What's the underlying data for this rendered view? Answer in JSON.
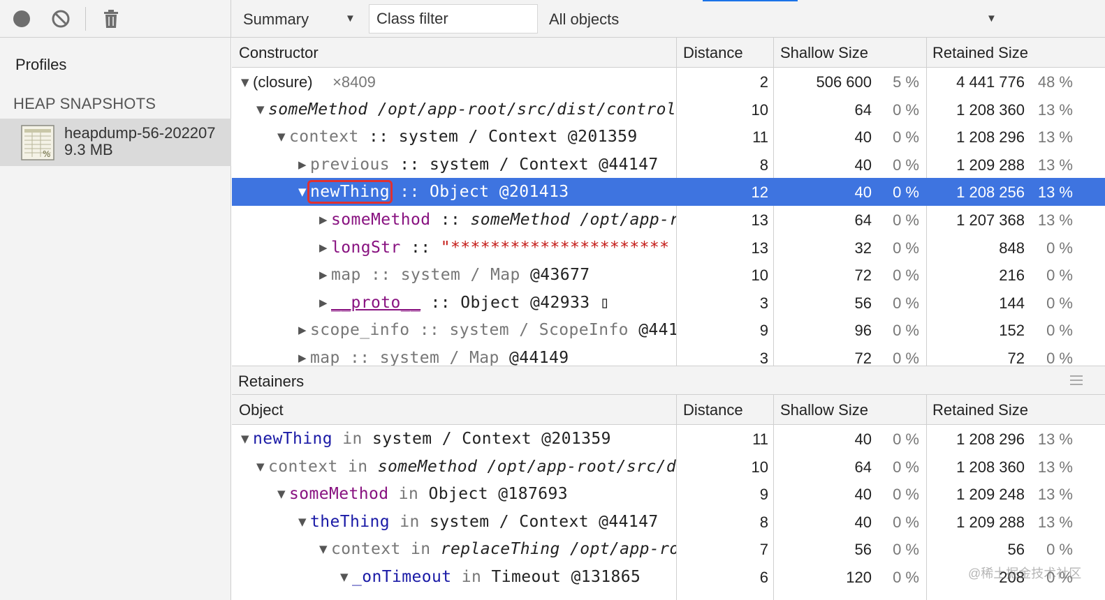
{
  "toolbar": {
    "view_select": "Summary",
    "class_filter_placeholder": "Class filter",
    "objects_select": "All objects"
  },
  "sidebar": {
    "profiles_label": "Profiles",
    "section_heading": "HEAP SNAPSHOTS",
    "snapshot": {
      "name": "heapdump-56-202207",
      "size": "9.3 MB"
    }
  },
  "constructor_table": {
    "headers": {
      "name": "Constructor",
      "distance": "Distance",
      "shallow": "Shallow Size",
      "retained": "Retained Size"
    },
    "rows": [
      {
        "dist": "2",
        "sh": "506 600",
        "shp": "5 %",
        "ret": "4 441 776",
        "retp": "48 %",
        "n1": "(closure)",
        "n2": "×8409"
      },
      {
        "dist": "10",
        "sh": "64",
        "shp": "0 %",
        "ret": "1 208 360",
        "retp": "13 %",
        "n1": "someMethod /opt/app-root/src/dist/control"
      },
      {
        "dist": "11",
        "sh": "40",
        "shp": "0 %",
        "ret": "1 208 296",
        "retp": "13 %",
        "n1": "context",
        "n2": " :: ",
        "n3": "system / Context @201359"
      },
      {
        "dist": "8",
        "sh": "40",
        "shp": "0 %",
        "ret": "1 209 288",
        "retp": "13 %",
        "n1": "previous",
        "n2": " :: ",
        "n3": "system / Context @44147"
      },
      {
        "dist": "12",
        "sh": "40",
        "shp": "0 %",
        "ret": "1 208 256",
        "retp": "13 %",
        "n1": "newThing",
        "n2": " :: ",
        "n3": "Object @201413"
      },
      {
        "dist": "13",
        "sh": "64",
        "shp": "0 %",
        "ret": "1 207 368",
        "retp": "13 %",
        "n1": "someMethod",
        "n2": " :: ",
        "n3": "someMethod /opt/app-r"
      },
      {
        "dist": "13",
        "sh": "32",
        "shp": "0 %",
        "ret": "848",
        "retp": "0 %",
        "n1": "longStr",
        "n2": " :: ",
        "n3": "\"**********************"
      },
      {
        "dist": "10",
        "sh": "72",
        "shp": "0 %",
        "ret": "216",
        "retp": "0 %",
        "n1": "map",
        "n2": " :: ",
        "n3": "system / Map ",
        "n4": "@43677"
      },
      {
        "dist": "3",
        "sh": "56",
        "shp": "0 %",
        "ret": "144",
        "retp": "0 %",
        "n1": "__proto__",
        "n2": " :: ",
        "n3": "Object @42933 ▯"
      },
      {
        "dist": "9",
        "sh": "96",
        "shp": "0 %",
        "ret": "152",
        "retp": "0 %",
        "n1": "scope_info",
        "n2": " :: ",
        "n3": "system / ScopeInfo ",
        "n4": "@441"
      },
      {
        "dist": "3",
        "sh": "72",
        "shp": "0 %",
        "ret": "72",
        "retp": "0 %",
        "n1": "map",
        "n2": " :: ",
        "n3": "system / Map ",
        "n4": "@44149"
      }
    ]
  },
  "retainers": {
    "title": "Retainers",
    "headers": {
      "name": "Object",
      "distance": "Distance",
      "shallow": "Shallow Size",
      "retained": "Retained Size"
    },
    "rows": [
      {
        "dist": "11",
        "sh": "40",
        "shp": "0 %",
        "ret": "1 208 296",
        "retp": "13 %",
        "n1": "newThing",
        "n2": " in ",
        "n3": "system / Context @201359"
      },
      {
        "dist": "10",
        "sh": "64",
        "shp": "0 %",
        "ret": "1 208 360",
        "retp": "13 %",
        "n1": "context",
        "n2": " in ",
        "n3": "someMethod /opt/app-root/src/d"
      },
      {
        "dist": "9",
        "sh": "40",
        "shp": "0 %",
        "ret": "1 209 248",
        "retp": "13 %",
        "n1": "someMethod",
        "n2": " in ",
        "n3": "Object @187693"
      },
      {
        "dist": "8",
        "sh": "40",
        "shp": "0 %",
        "ret": "1 209 288",
        "retp": "13 %",
        "n1": "theThing",
        "n2": " in ",
        "n3": "system / Context @44147"
      },
      {
        "dist": "7",
        "sh": "56",
        "shp": "0 %",
        "ret": "56",
        "retp": "0 %",
        "n1": "context",
        "n2": " in ",
        "n3": "replaceThing /opt/app-ro"
      },
      {
        "dist": "6",
        "sh": "120",
        "shp": "0 %",
        "ret": "208",
        "retp": "0 %",
        "n1": "_onTimeout",
        "n2": " in ",
        "n3": "Timeout @131865"
      }
    ]
  },
  "watermark": "@稀土掘金技术社区",
  "colors": {
    "selection": "#3e74e0",
    "property": "#881280",
    "retainer_name": "#1a1aa6",
    "string": "#c41a16",
    "highlight_box": "#e03030"
  }
}
